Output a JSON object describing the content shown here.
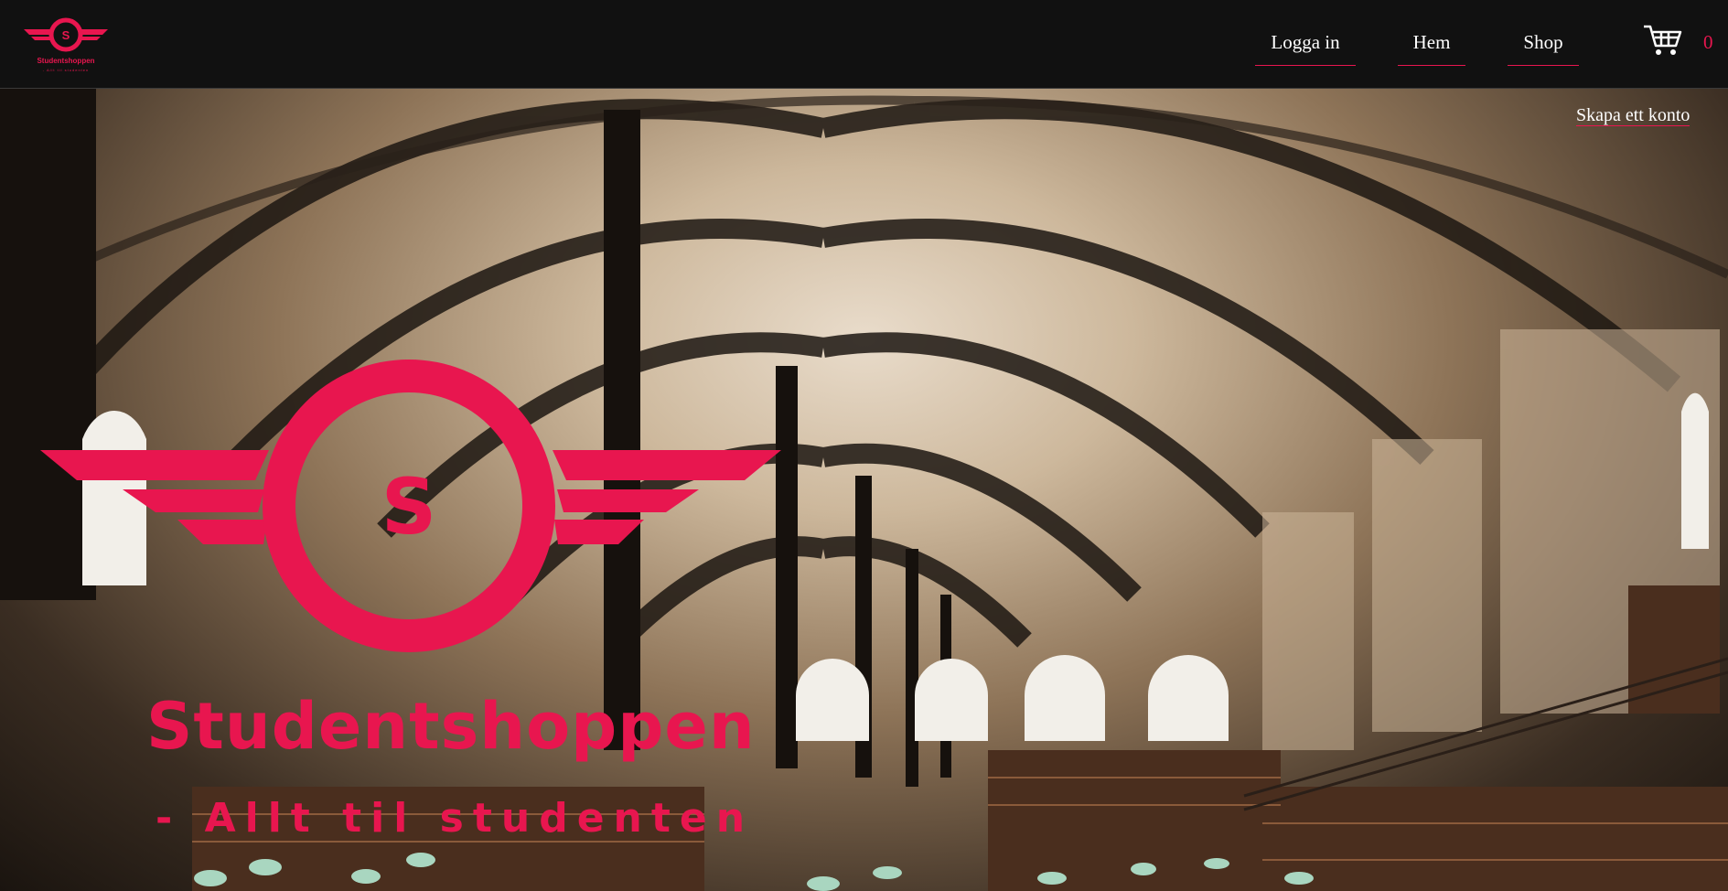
{
  "brand": {
    "name": "Studentshoppen",
    "tagline": "- Allt til studenten",
    "logo_letter": "S",
    "accent_color": "#e8164f"
  },
  "nav": {
    "items": [
      {
        "label": "Logga in"
      },
      {
        "label": "Hem"
      },
      {
        "label": "Shop"
      }
    ],
    "cart": {
      "icon": "shopping-cart-icon",
      "count": "0"
    }
  },
  "account": {
    "create_label": "Skapa ett konto"
  },
  "hero": {
    "background": "library reading room photo",
    "title": "Studentshoppen",
    "tagline": "- Allt til studenten",
    "logo_letter": "S"
  }
}
